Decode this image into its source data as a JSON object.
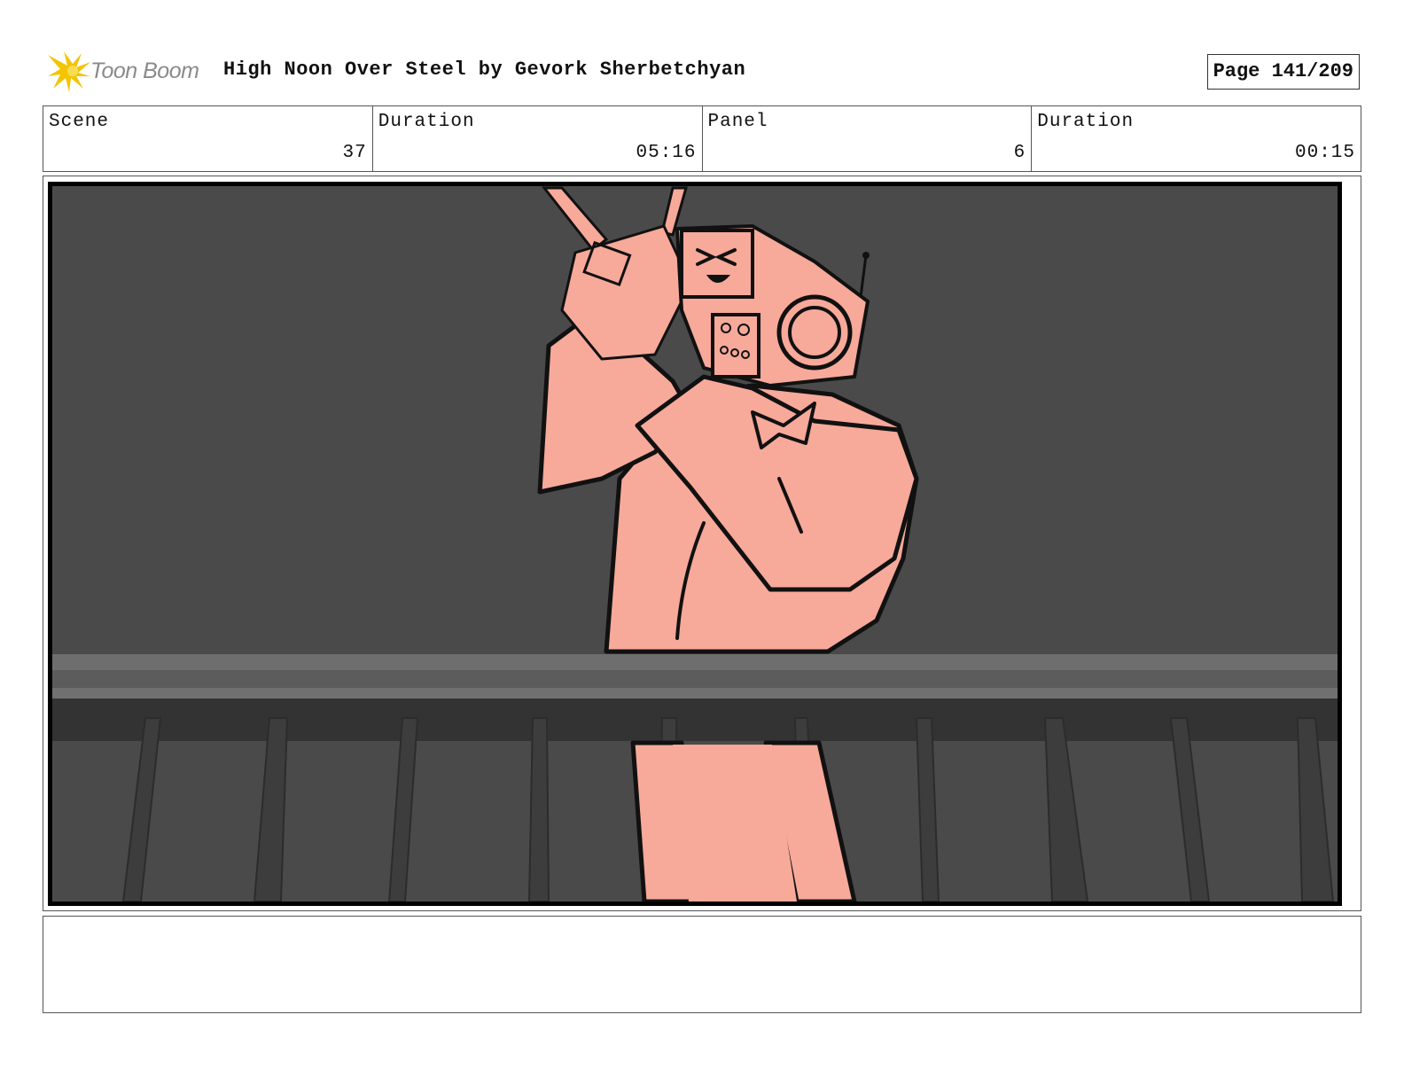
{
  "header": {
    "logo_text": "Toon Boom",
    "title": "High Noon Over Steel by Gevork Sherbetchyan",
    "page_label": "Page 141/209"
  },
  "info": {
    "scene_label": "Scene",
    "scene_value": "37",
    "scene_duration_label": "Duration",
    "scene_duration_value": "05:16",
    "panel_label": "Panel",
    "panel_value": "6",
    "panel_duration_label": "Duration",
    "panel_duration_value": "00:15"
  },
  "notes": {
    "text": ""
  },
  "colors": {
    "character_fill": "#f7a99a",
    "background": "#4a4a4a",
    "line": "#111111",
    "logo_yellow": "#f5c400"
  }
}
